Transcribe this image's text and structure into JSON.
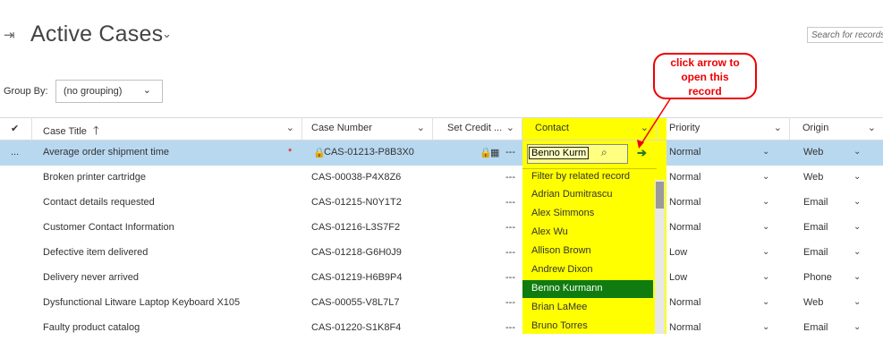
{
  "header": {
    "title": "Active Cases",
    "search_placeholder": "Search for records"
  },
  "groupby": {
    "label": "Group By:",
    "value": "(no grouping)"
  },
  "columns": {
    "case_title": "Case Title",
    "case_number": "Case Number",
    "set_credit": "Set Credit ...",
    "contact": "Contact",
    "priority": "Priority",
    "origin": "Origin"
  },
  "rows": [
    {
      "title": "Average order shipment time",
      "number": "CAS-01213-P8B3X0",
      "priority": "Normal",
      "origin": "Web"
    },
    {
      "title": "Broken printer cartridge",
      "number": "CAS-00038-P4X8Z6",
      "priority": "Normal",
      "origin": "Web"
    },
    {
      "title": "Contact details requested",
      "number": "CAS-01215-N0Y1T2",
      "priority": "Normal",
      "origin": "Email"
    },
    {
      "title": "Customer Contact Information",
      "number": "CAS-01216-L3S7F2",
      "priority": "Normal",
      "origin": "Email"
    },
    {
      "title": "Defective item delivered",
      "number": "CAS-01218-G6H0J9",
      "priority": "Low",
      "origin": "Email"
    },
    {
      "title": "Delivery never arrived",
      "number": "CAS-01219-H6B9P4",
      "priority": "Low",
      "origin": "Phone"
    },
    {
      "title": "Dysfunctional Litware Laptop Keyboard X105",
      "number": "CAS-00055-V8L7L7",
      "priority": "Normal",
      "origin": "Web"
    },
    {
      "title": "Faulty product catalog",
      "number": "CAS-01220-S1K8F4",
      "priority": "Normal",
      "origin": "Email"
    }
  ],
  "row_menu": "...",
  "dash": "---",
  "lookup": {
    "value": "Benno Kurm",
    "items": [
      "Filter by related record",
      "Adrian Dumitrascu",
      "Alex Simmons",
      "Alex Wu",
      "Allison Brown",
      "Andrew Dixon",
      "Benno Kurmann",
      "Brian LaMee",
      "Bruno Torres"
    ]
  },
  "callout": {
    "line1": "click arrow to",
    "line2": "open this",
    "line3": "record"
  },
  "colors": {
    "highlight": "#ffff00",
    "selected_row": "#b8d8f0",
    "selected_item": "#107c10",
    "callout": "#ee0000"
  }
}
